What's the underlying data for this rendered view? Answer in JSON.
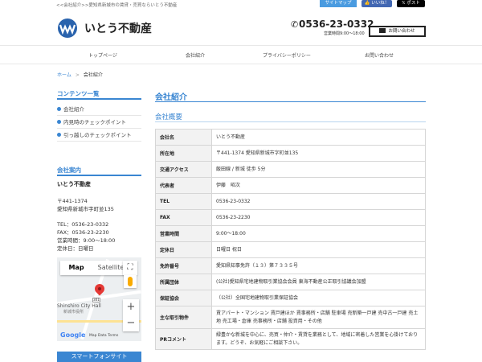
{
  "topbar": {
    "tagline": "<<会社紹介>>愛知県新城市の賃貸・売買ならいとう不動産",
    "sitemap": "サイトマップ",
    "like": "いいね！",
    "post": "ポスト"
  },
  "header": {
    "company_name": "いとう不動産",
    "phone": "0536-23-0332",
    "hours": "営業時間9:00～18:00",
    "contact_button": "お問い合わせ"
  },
  "nav": {
    "items": [
      {
        "label": "トップページ"
      },
      {
        "label": "会社紹介"
      },
      {
        "label": "プライバシーポリシー"
      },
      {
        "label": "お問い合わせ"
      }
    ]
  },
  "breadcrumb": {
    "home": "ホーム",
    "separator": ">",
    "current": "会社紹介"
  },
  "sidebar": {
    "contents_title": "コンテンツ一覧",
    "items": [
      {
        "label": "会社紹介"
      },
      {
        "label": "内見時のチェックポイント"
      },
      {
        "label": "引っ越しのチェックポイント"
      }
    ],
    "info_title": "会社案内",
    "info": {
      "name": "いとう不動産",
      "zip": "〒441-1374",
      "address": "愛知県新城市字町並135",
      "tel": "TEL：0536-23-0332",
      "fax": "FAX：0536-23-2230",
      "hours": "営業時間：9:00～18:00",
      "holiday": "定休日：日曜日"
    },
    "map": {
      "tab_map": "Map",
      "tab_satellite": "Satellite",
      "place_label": "Shinshiro City Hall",
      "place_label_jp": "新城市役所",
      "route_number": "301",
      "logo": "Google",
      "attribution": "Map Data   Terms"
    },
    "smartphone_button": "スマートフォンサイト"
  },
  "main": {
    "title": "会社紹介",
    "section_title": "会社概要",
    "table": [
      {
        "key": "会社名",
        "value": "いとう不動産"
      },
      {
        "key": "所在地",
        "value": "〒441-1374 愛知県新城市字町並135"
      },
      {
        "key": "交通アクセス",
        "value": "飯田線 / 新城 徒歩 5分"
      },
      {
        "key": "代表者",
        "value": "伊藤　昭次"
      },
      {
        "key": "TEL",
        "value": "0536-23-0332"
      },
      {
        "key": "FAX",
        "value": "0536-23-2230"
      },
      {
        "key": "営業時間",
        "value": "9:00～18:00"
      },
      {
        "key": "定休日",
        "value": "日曜日 祝日"
      },
      {
        "key": "免許番号",
        "value": "愛知県知事免許（１３）第７３３５号"
      },
      {
        "key": "所属団体",
        "value": "(公社)愛知県宅地建物取引業協会会員 東海不動産公正取引協議会加盟"
      },
      {
        "key": "保証協会",
        "value": "（公社）全国宅地建物取引業保証協会"
      },
      {
        "key": "主な取引物件",
        "value": "賃アパート・マンション 賃戸建ほか 賃事務所・店舗 駐車場 売新築一戸建 売中古一戸建 売土地 売工場・倉庫 売事務所・店舗 投資用・その他"
      },
      {
        "key": "PRコメント",
        "value": "緑豊かな新城を中心に、売買・仲介・賃貸を業務として、地域に密着した営業を心掛けております。どうぞ、お気軽にご相談下さい。"
      }
    ]
  },
  "colors": {
    "accent": "#3a86d2",
    "facebook": "#4267b2"
  }
}
